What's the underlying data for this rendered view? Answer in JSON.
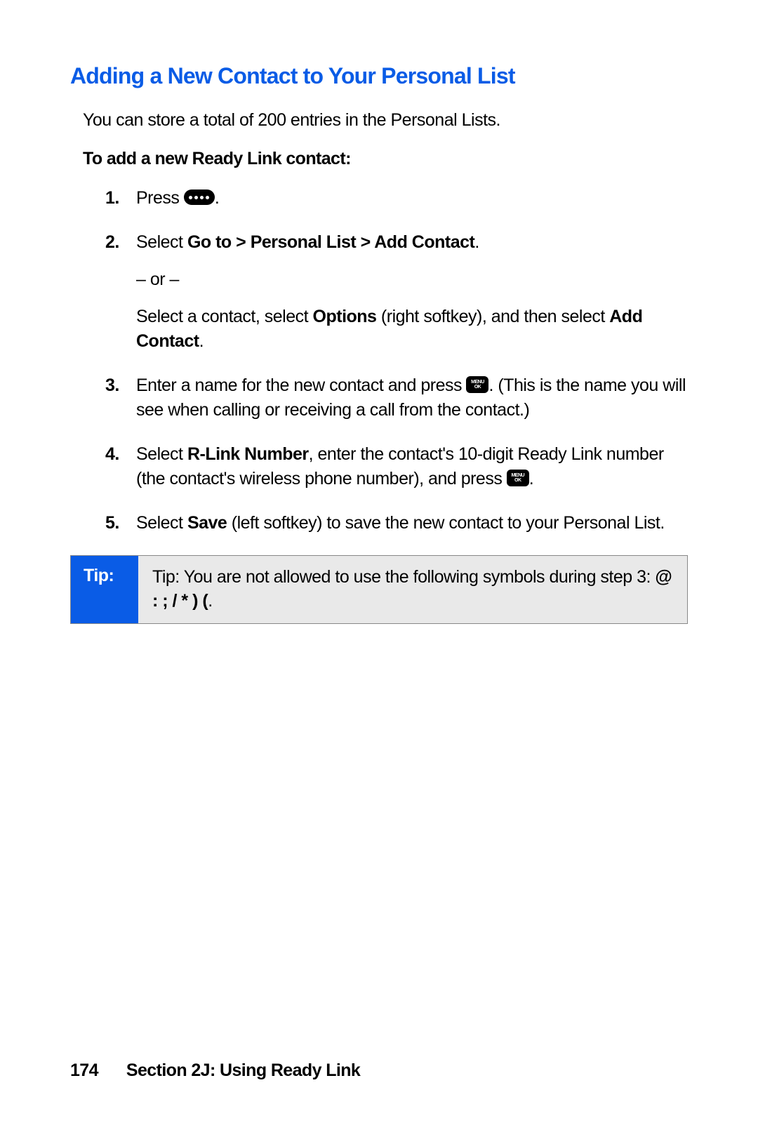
{
  "heading": "Adding a New Contact to Your Personal List",
  "intro": "You can store a total of 200 entries in the Personal Lists.",
  "subheading": "To add a new Ready Link contact:",
  "steps": {
    "n1": "1.",
    "s1_a": "Press ",
    "s1_b": ".",
    "n2": "2.",
    "s2_a": "Select ",
    "s2_b": "Go to > Personal List > Add Contact",
    "s2_c": ".",
    "s2_or": "– or –",
    "s2_d": "Select a contact, select ",
    "s2_e": "Options",
    "s2_f": " (right softkey), and then select ",
    "s2_g": "Add Contact",
    "s2_h": ".",
    "n3": "3.",
    "s3_a": "Enter a name for the new contact and press ",
    "s3_b": ". (This is the name you will see when calling or receiving a call from the contact.)",
    "n4": "4.",
    "s4_a": "Select ",
    "s4_b": "R-Link Number",
    "s4_c": ", enter the contact's 10-digit Ready Link number (the contact's wireless phone number), and press ",
    "s4_d": ".",
    "n5": "5.",
    "s5_a": "Select ",
    "s5_b": "Save",
    "s5_c": " (left softkey) to save the new contact to your Personal List."
  },
  "tip": {
    "label": "Tip:",
    "content_a": "Tip: You are not allowed to use the following symbols during step 3: ",
    "content_b": "@  :  ;  /  *  )  (",
    "content_c": "."
  },
  "footer": {
    "page": "174",
    "section": "Section 2J: Using Ready Link"
  },
  "icons": {
    "menu": "MENU",
    "ok": "OK"
  }
}
